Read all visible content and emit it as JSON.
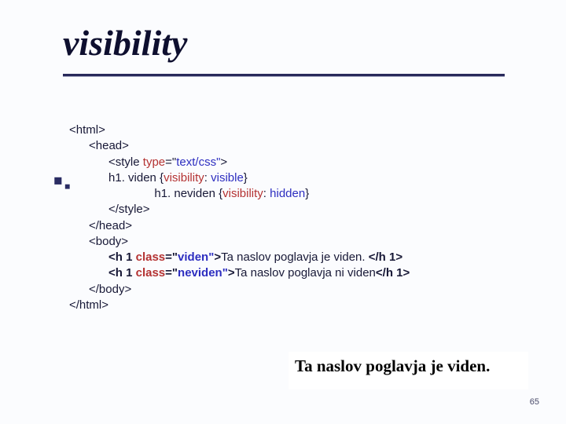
{
  "title": "visibility",
  "code": {
    "l1": "<html>",
    "l2": "      <head>",
    "l3a": "            <style ",
    "l3_attr": "type",
    "l3_eq": "=\"",
    "l3_val": "text/css\"",
    "l3b": ">",
    "l4a": "            h1. viden {",
    "l4_prop": "visibility",
    "l4_mid": ": ",
    "l4_val": "visible",
    "l4b": "}",
    "l5a": "                          h1. neviden {",
    "l5_prop": "visibility",
    "l5_mid": ": ",
    "l5_val": "hidden",
    "l5b": "}",
    "l6": "            </style>",
    "l7": "      </head>",
    "l8": "      <body>",
    "l9a": "            <h 1 ",
    "l9_attr": "class",
    "l9_eq": "=\"",
    "l9_val": "viden\"",
    "l9b": ">",
    "l9_txt": "Ta naslov poglavja je viden. ",
    "l9c": "</h 1>",
    "l10a": "            <h 1 ",
    "l10_attr": "class",
    "l10_eq": "=\"",
    "l10_val": "neviden\"",
    "l10b": ">",
    "l10_txt": "Ta naslov poglavja ni viden",
    "l10c": "</h 1>",
    "l11": "      </body>",
    "l12": "</html>"
  },
  "output_text": "Ta naslov poglavja je viden.",
  "page_number": "65"
}
